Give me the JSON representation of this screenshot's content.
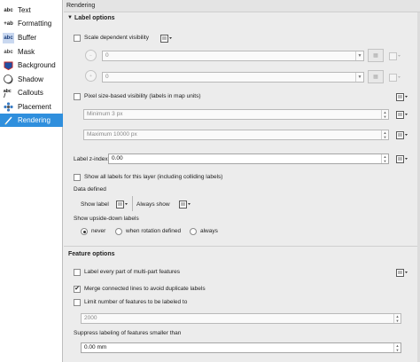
{
  "sidebar": {
    "items": [
      {
        "label": "Text",
        "icon": "abc-text-icon",
        "glyph": "abc"
      },
      {
        "label": "Formatting",
        "icon": "formatting-icon",
        "glyph": "+ab"
      },
      {
        "label": "Buffer",
        "icon": "buffer-icon",
        "glyph": "abc"
      },
      {
        "label": "Mask",
        "icon": "mask-icon",
        "glyph": "abc"
      },
      {
        "label": "Background",
        "icon": "background-icon",
        "glyph": ""
      },
      {
        "label": "Shadow",
        "icon": "shadow-icon",
        "glyph": ""
      },
      {
        "label": "Callouts",
        "icon": "callouts-icon",
        "glyph": "abc"
      },
      {
        "label": "Placement",
        "icon": "placement-icon",
        "glyph": ""
      },
      {
        "label": "Rendering",
        "icon": "rendering-icon",
        "glyph": ""
      }
    ],
    "selected": "Rendering"
  },
  "panel": {
    "title": "Rendering"
  },
  "label_options": {
    "heading": "Label options",
    "scale_dependent": "Scale dependent visibility",
    "min_scale": "0",
    "max_scale": "0",
    "pixel_size": "Pixel size-based visibility (labels in map units)",
    "min_px": "Minimum 3 px",
    "max_px": "Maximum 10000 px",
    "z_index_label": "Label z-index",
    "z_index_value": "0.00",
    "show_all": "Show all labels for this layer (including colliding labels)",
    "data_defined": "Data defined",
    "show_label": "Show label",
    "always_show": "Always show",
    "upside_down": "Show upside-down labels",
    "radio_never": "never",
    "radio_rotation": "when rotation defined",
    "radio_always": "always"
  },
  "feature_options": {
    "heading": "Feature options",
    "every_part": "Label every part of multi-part features",
    "merge_lines": "Merge connected lines to avoid duplicate labels",
    "merge_checked": "✔",
    "limit_number": "Limit number of features to be labeled to",
    "limit_value": "2000",
    "suppress": "Suppress labeling of features smaller than",
    "suppress_value": "0.00 mm"
  }
}
